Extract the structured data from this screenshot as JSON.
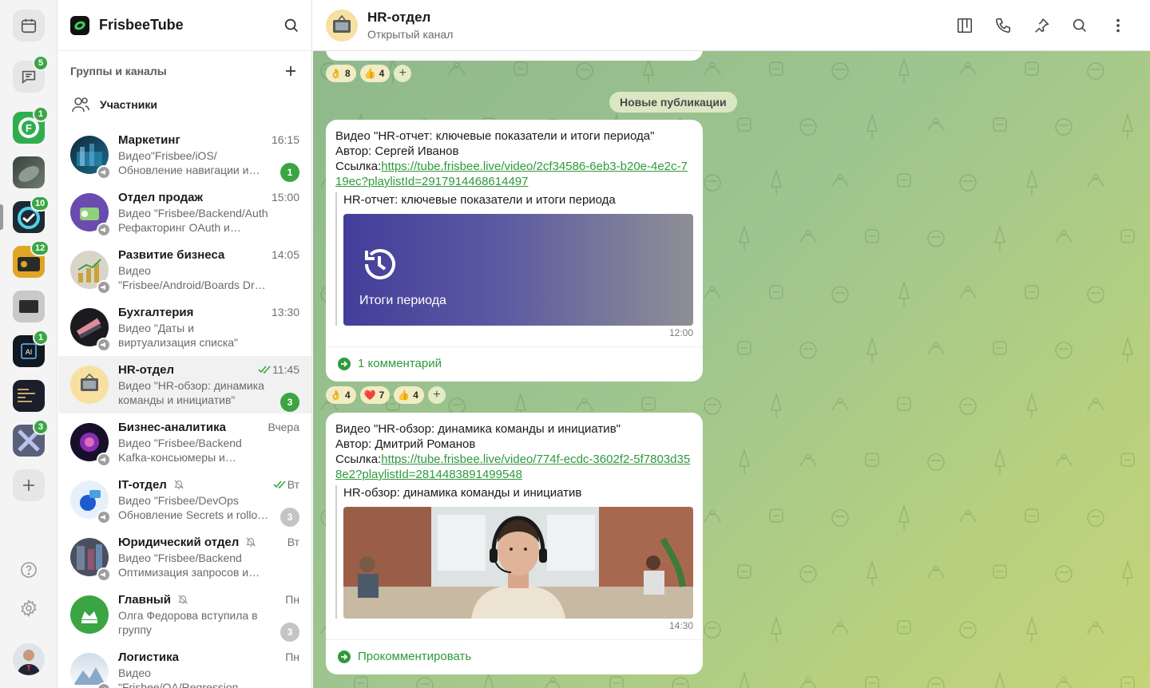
{
  "app": {
    "name": "FrisbeeTube"
  },
  "rail": {
    "badges": {
      "chats": "5",
      "app1": "1",
      "app3": "10",
      "app4": "12",
      "app6": "1",
      "app8": "3"
    }
  },
  "sidebar": {
    "section_title": "Группы и каналы",
    "members_label": "Участники",
    "chats": [
      {
        "name": "Маркетинг",
        "time": "16:15",
        "preview": "Видео\"Frisbee/iOS/ Обновление навигации и…",
        "unread": "1"
      },
      {
        "name": "Отдел продаж",
        "time": "15:00",
        "preview": "Видео \"Frisbee/Backend/Auth Рефакторинг OAuth и…",
        "unread": ""
      },
      {
        "name": "Развитие бизнеса",
        "time": "14:05",
        "preview": "Видео \"Frisbee/Android/Boards Drag & Drop и оптимизация…",
        "unread": ""
      },
      {
        "name": "Бухгалтерия",
        "time": "13:30",
        "preview": "Видео \"Даты и виртуализация списка\"",
        "unread": ""
      },
      {
        "name": "HR-отдел",
        "time": "11:45",
        "preview": "Видео \"HR-обзор: динамика команды и инициатив\"",
        "unread": "3"
      },
      {
        "name": "Бизнес-аналитика",
        "time": "Вчера",
        "preview": "Видео \"Frisbee/Backend Kafka-консьюмеры и обработка…",
        "unread": ""
      },
      {
        "name": "IT-отдел",
        "time": "Вт",
        "preview": "Видео \"Frisbee/DevOps Обновление Secrets и rollo…",
        "unread": "3"
      },
      {
        "name": "Юридический отдел",
        "time": "Вт",
        "preview": "Видео \"Frisbee/Backend Оптимизация запросов и…",
        "unread": ""
      },
      {
        "name": "Главный",
        "time": "Пн",
        "preview": "Олга Федорова вступила в группу",
        "unread": "3"
      },
      {
        "name": "Логистика",
        "time": "Пн",
        "preview": "Видео \"Frisbee/QA/Regression Автотесты и стабилизация…",
        "unread": ""
      }
    ]
  },
  "channel": {
    "title": "HR-отдел",
    "subtitle": "Открытый канал"
  },
  "feed": {
    "top_reactions": [
      {
        "emoji": "👌",
        "count": "8"
      },
      {
        "emoji": "👍",
        "count": "4"
      }
    ],
    "new_posts_label": "Новые публикации",
    "messages": [
      {
        "line1": "Видео \"HR-отчет: ключевые показатели и итоги периода\"",
        "line2": "Автор: Сергей Иванов",
        "link_prefix": "Ссылка:",
        "link": "https://tube.frisbee.live/video/2cf34586-6eb3-b20e-4e2c-719ec?playlistId=2917914468614497",
        "quote_title": "HR-отчет: ключевые показатели и итоги периода",
        "image_caption": "Итоги периода",
        "time": "12:00",
        "comment_label": "1 комментарий",
        "reactions": [
          {
            "emoji": "👌",
            "count": "4"
          },
          {
            "emoji": "❤️",
            "count": "7"
          },
          {
            "emoji": "👍",
            "count": "4"
          }
        ]
      },
      {
        "line1": "Видео \"HR-обзор: динамика команды и инициатив\"",
        "line2": "Автор: Дмитрий Романов",
        "link_prefix": "Ссылка:",
        "link": "https://tube.frisbee.live/video/774f-ecdc-3602f2-5f7803d358e2?playlistId=2814483891499548",
        "quote_title": "HR-обзор: динамика команды и инициатив",
        "time": "14:30",
        "comment_label": "Прокомментировать"
      }
    ]
  },
  "colors": {
    "accent": "#3ba544",
    "link": "#2e9a3c",
    "badge_muted": "#c4c4c4"
  }
}
